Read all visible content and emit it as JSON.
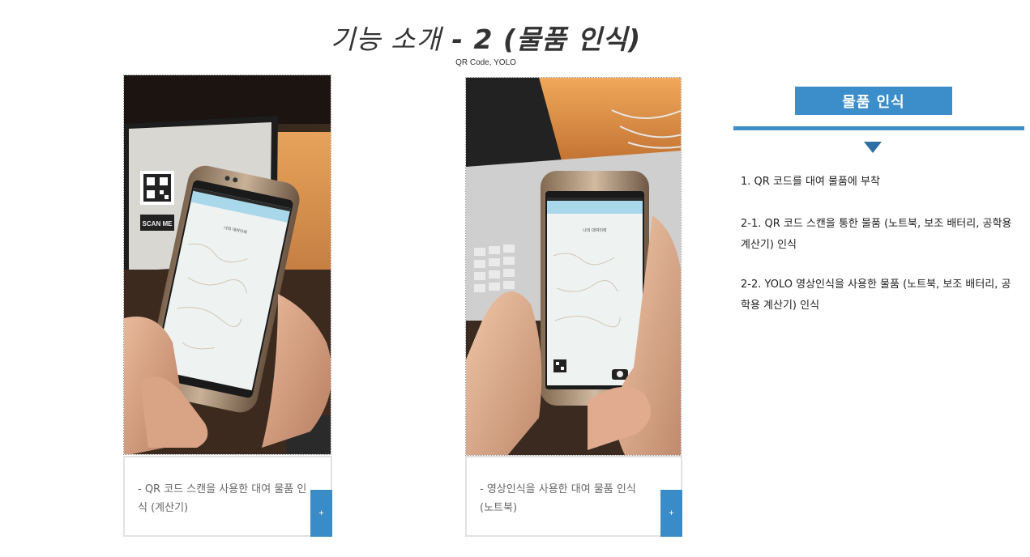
{
  "header": {
    "title_plain": "기능 소개",
    "title_bold": " - 2 (물품 인식)",
    "subtitle": "QR Code, YOLO"
  },
  "cards": [
    {
      "caption": " - QR 코드 스캔을 사용한 대여 물품 인식 (계산기)",
      "plus_label": "+",
      "phone_title": "나의 대여이력",
      "laptop_sticker": "SCAN ME"
    },
    {
      "caption": " - 영상인식을 사용한 대여 물품 인식 (노트북)",
      "plus_label": "+",
      "phone_title": "나의 대여이력"
    }
  ],
  "sidebar": {
    "header": "물품 인식",
    "items": [
      "1. QR 코드를 대여 물품에 부착",
      "2-1. QR 코드 스캔을 통한 물품 (노트북, 보조 배터리, 공학용 계산기) 인식",
      "2-2. YOLO 영상인식을 사용한 물품 (노트북, 보조 배터리, 공학용 계산기) 인식"
    ]
  },
  "colors": {
    "accent": "#3b8ec9",
    "arrow": "#2e6fa6"
  }
}
